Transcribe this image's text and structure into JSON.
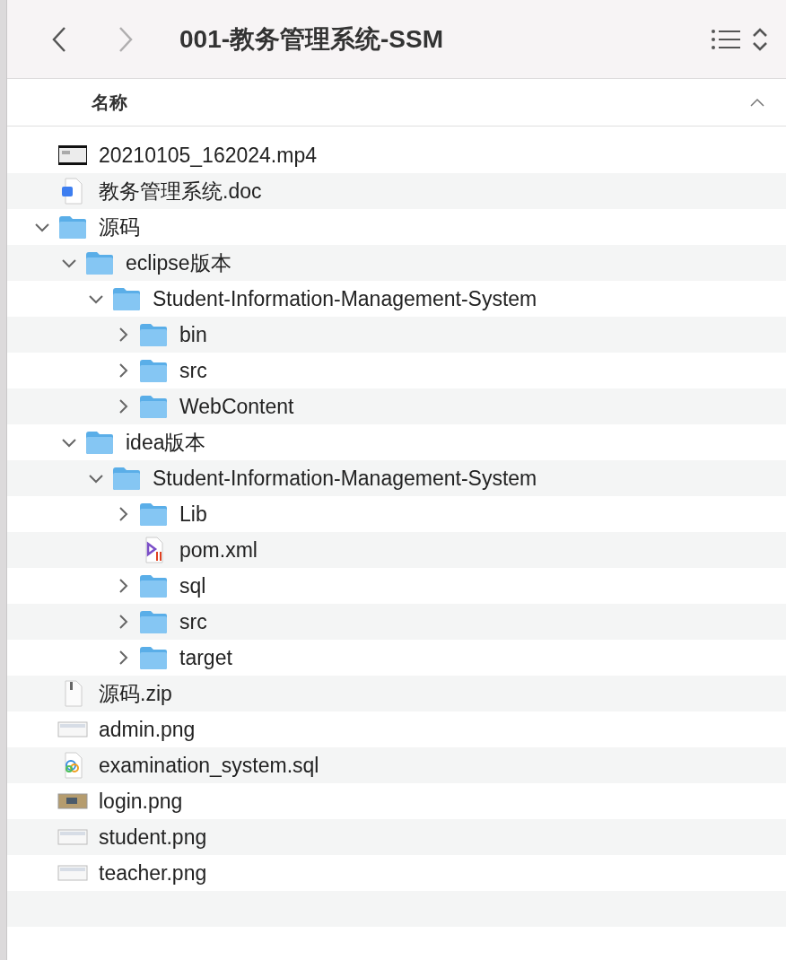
{
  "window": {
    "title": "001-教务管理系统-SSM"
  },
  "column_header": {
    "label": "名称",
    "sort_ascending": true
  },
  "files": [
    {
      "name": "20210105_162024.mp4",
      "kind": "video"
    },
    {
      "name": "教务管理系统.doc",
      "kind": "doc"
    },
    {
      "name": "源码",
      "kind": "folder",
      "expanded": true,
      "children": [
        {
          "name": "eclipse版本",
          "kind": "folder",
          "expanded": true,
          "children": [
            {
              "name": "Student-Information-Management-System",
              "kind": "folder",
              "expanded": true,
              "children": [
                {
                  "name": "bin",
                  "kind": "folder",
                  "expanded": false
                },
                {
                  "name": "src",
                  "kind": "folder",
                  "expanded": false
                },
                {
                  "name": "WebContent",
                  "kind": "folder",
                  "expanded": false
                }
              ]
            }
          ]
        },
        {
          "name": "idea版本",
          "kind": "folder",
          "expanded": true,
          "children": [
            {
              "name": "Student-Information-Management-System",
              "kind": "folder",
              "expanded": true,
              "children": [
                {
                  "name": "Lib",
                  "kind": "folder",
                  "expanded": false
                },
                {
                  "name": "pom.xml",
                  "kind": "xml"
                },
                {
                  "name": "sql",
                  "kind": "folder",
                  "expanded": false
                },
                {
                  "name": "src",
                  "kind": "folder",
                  "expanded": false
                },
                {
                  "name": "target",
                  "kind": "folder",
                  "expanded": false
                }
              ]
            }
          ]
        }
      ]
    },
    {
      "name": "源码.zip",
      "kind": "zip"
    },
    {
      "name": "admin.png",
      "kind": "image"
    },
    {
      "name": "examination_system.sql",
      "kind": "sql"
    },
    {
      "name": "login.png",
      "kind": "photo"
    },
    {
      "name": "student.png",
      "kind": "image"
    },
    {
      "name": "teacher.png",
      "kind": "image"
    }
  ]
}
